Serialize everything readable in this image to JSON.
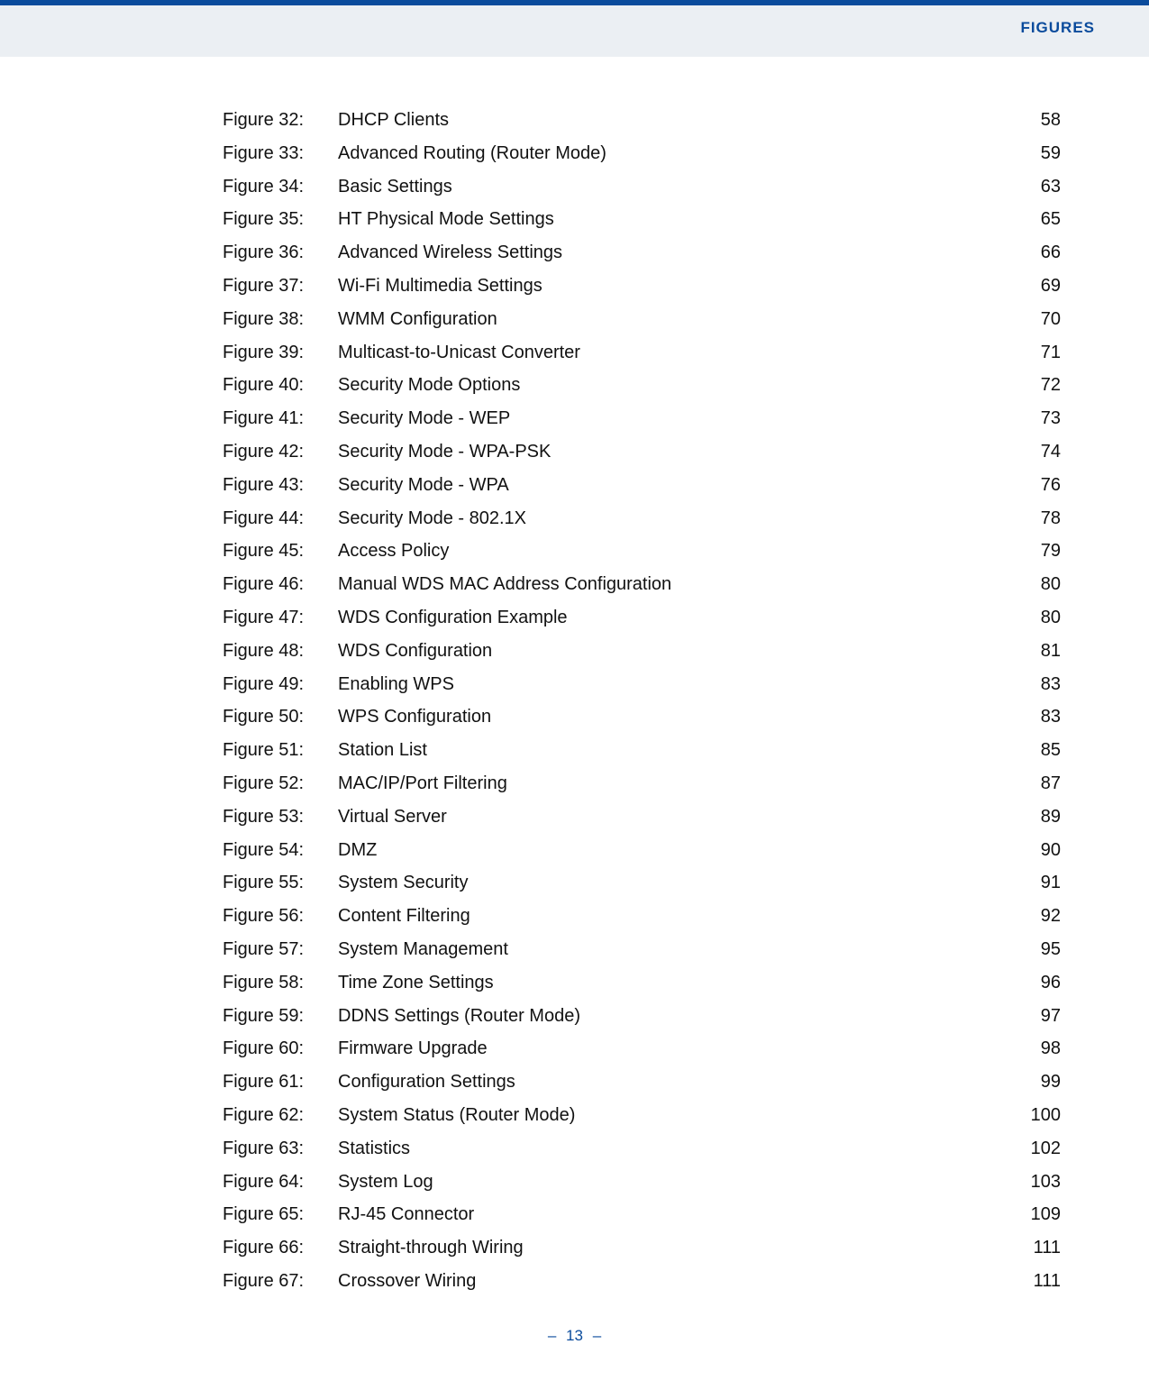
{
  "header": {
    "label": "FIGURES"
  },
  "figures": [
    {
      "num": "Figure 32:",
      "title": "DHCP Clients",
      "page": "58"
    },
    {
      "num": "Figure 33:",
      "title": "Advanced Routing (Router Mode)",
      "page": "59"
    },
    {
      "num": "Figure 34:",
      "title": "Basic Settings",
      "page": "63"
    },
    {
      "num": "Figure 35:",
      "title": "HT Physical Mode Settings",
      "page": "65"
    },
    {
      "num": "Figure 36:",
      "title": "Advanced Wireless Settings",
      "page": "66"
    },
    {
      "num": "Figure 37:",
      "title": "Wi-Fi Multimedia Settings",
      "page": "69"
    },
    {
      "num": "Figure 38:",
      "title": "WMM Configuration",
      "page": "70"
    },
    {
      "num": "Figure 39:",
      "title": "Multicast-to-Unicast Converter",
      "page": "71"
    },
    {
      "num": "Figure 40:",
      "title": "Security Mode Options",
      "page": "72"
    },
    {
      "num": "Figure 41:",
      "title": "Security Mode - WEP",
      "page": "73"
    },
    {
      "num": "Figure 42:",
      "title": "Security Mode - WPA-PSK",
      "page": "74"
    },
    {
      "num": "Figure 43:",
      "title": "Security Mode - WPA",
      "page": "76"
    },
    {
      "num": "Figure 44:",
      "title": "Security Mode - 802.1X",
      "page": "78"
    },
    {
      "num": "Figure 45:",
      "title": "Access Policy",
      "page": "79"
    },
    {
      "num": "Figure 46:",
      "title": "Manual WDS MAC Address Configuration",
      "page": "80"
    },
    {
      "num": "Figure 47:",
      "title": "WDS Configuration Example",
      "page": "80"
    },
    {
      "num": "Figure 48:",
      "title": "WDS Configuration",
      "page": "81"
    },
    {
      "num": "Figure 49:",
      "title": "Enabling WPS",
      "page": "83"
    },
    {
      "num": "Figure 50:",
      "title": "WPS Configuration",
      "page": "83"
    },
    {
      "num": "Figure 51:",
      "title": "Station List",
      "page": "85"
    },
    {
      "num": "Figure 52:",
      "title": "MAC/IP/Port Filtering",
      "page": "87"
    },
    {
      "num": "Figure 53:",
      "title": "Virtual Server",
      "page": "89"
    },
    {
      "num": "Figure 54:",
      "title": "DMZ",
      "page": "90"
    },
    {
      "num": "Figure 55:",
      "title": "System Security",
      "page": "91"
    },
    {
      "num": "Figure 56:",
      "title": "Content Filtering",
      "page": "92"
    },
    {
      "num": "Figure 57:",
      "title": "System Management",
      "page": "95"
    },
    {
      "num": "Figure 58:",
      "title": "Time Zone Settings",
      "page": "96"
    },
    {
      "num": "Figure 59:",
      "title": "DDNS Settings (Router Mode)",
      "page": "97"
    },
    {
      "num": "Figure 60:",
      "title": "Firmware Upgrade",
      "page": "98"
    },
    {
      "num": "Figure 61:",
      "title": "Configuration Settings",
      "page": "99"
    },
    {
      "num": "Figure 62:",
      "title": "System Status (Router Mode)",
      "page": "100"
    },
    {
      "num": "Figure 63:",
      "title": "Statistics",
      "page": "102"
    },
    {
      "num": "Figure 64:",
      "title": "System Log",
      "page": "103"
    },
    {
      "num": "Figure 65:",
      "title": "RJ-45 Connector",
      "page": "109"
    },
    {
      "num": "Figure 66:",
      "title": "Straight-through Wiring",
      "page": "111"
    },
    {
      "num": "Figure 67:",
      "title": "Crossover Wiring",
      "page": "111"
    }
  ],
  "footer": {
    "dash": "–",
    "page": "13"
  }
}
